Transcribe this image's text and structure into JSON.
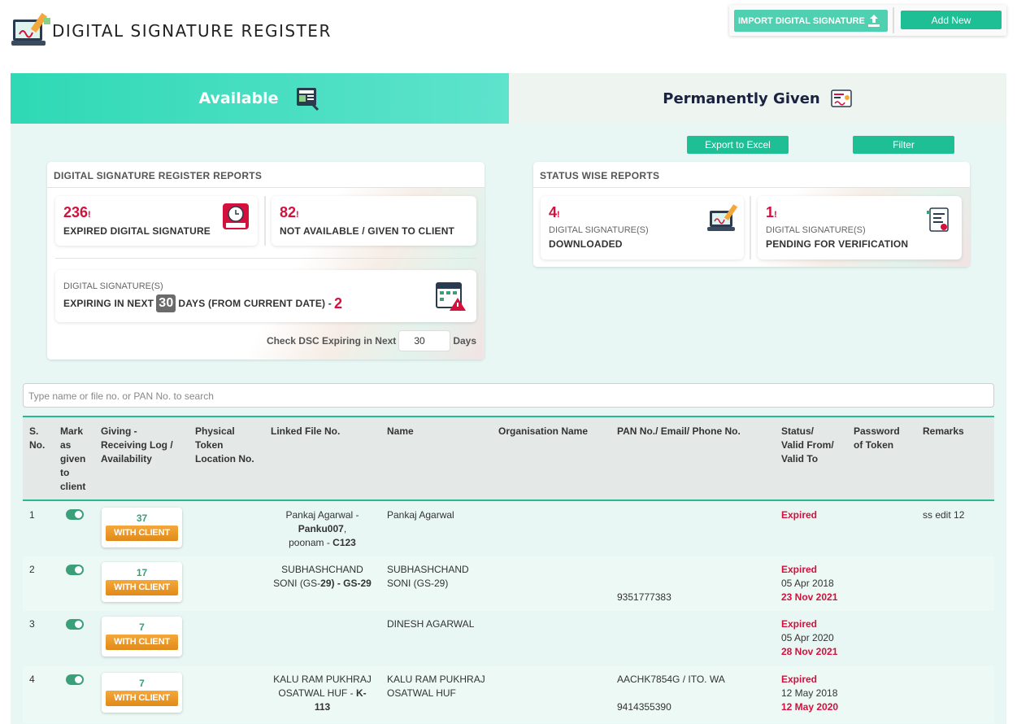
{
  "header": {
    "title": "DIGITAL SIGNATURE REGISTER",
    "import_label": "IMPORT DIGITAL SIGNATURE",
    "add_label": "Add New"
  },
  "tabs": {
    "available": "Available",
    "permanently_given": "Permanently Given"
  },
  "actions": {
    "export_label": "Export to Excel",
    "filter_label": "Filter"
  },
  "reports": {
    "title": "DIGITAL SIGNATURE REGISTER REPORTS",
    "expired_count": "236",
    "expired_label": "EXPIRED DIGITAL SIGNATURE",
    "not_available_count": "82",
    "not_available_label": "NOT AVAILABLE / GIVEN TO CLIENT",
    "expiring_sub": "DIGITAL SIGNATURE(S)",
    "expiring_prefix": "EXPIRING IN NEXT",
    "expiring_days": "30",
    "expiring_suffix": "DAYS (FROM CURRENT DATE) -",
    "expiring_count": "2",
    "check_label": "Check DSC Expiring in Next",
    "check_value": "30",
    "check_unit": "Days",
    "exclaim": "!"
  },
  "status_reports": {
    "title": "STATUS WISE REPORTS",
    "downloaded_count": "4",
    "downloaded_sub": "DIGITAL SIGNATURE(S)",
    "downloaded_label": "DOWNLOADED",
    "pending_count": "1",
    "pending_sub": "DIGITAL SIGNATURE(S)",
    "pending_label": "PENDING FOR VERIFICATION"
  },
  "search": {
    "placeholder": "Type name or file no. or PAN No. to search"
  },
  "table": {
    "headers": {
      "sno": [
        "S.",
        "No."
      ],
      "mark": [
        "Mark",
        "as",
        "given",
        "to",
        "client"
      ],
      "log": [
        "Giving -",
        "Receiving Log /",
        "Availability"
      ],
      "location": [
        "Physical",
        "Token",
        "Location No."
      ],
      "file": "Linked File No.",
      "name": "Name",
      "org": "Organisation Name",
      "pan": "PAN No./ Email/ Phone No.",
      "status": [
        "Status/",
        "Valid From/",
        "Valid To"
      ],
      "password": [
        "Password",
        "of Token"
      ],
      "remarks": "Remarks"
    },
    "badge_label": "WITH CLIENT",
    "rows": [
      {
        "sno": "1",
        "log_count": "37",
        "file_line1": "Pankaj Agarwal -",
        "file_bold1": "Panku007",
        "file_line2_tail": ",",
        "file_line3": "poonam -",
        "file_bold3": "C123",
        "name": "Pankaj Agarwal",
        "pan1": "",
        "pan2": "",
        "status": "Expired",
        "valid_from": "",
        "valid_to": "",
        "remarks": "ss edit 12"
      },
      {
        "sno": "2",
        "log_count": "17",
        "file_line1": "SUBHASHCHAND",
        "file_line2": "SONI (GS-",
        "file_bold2": "29) - GS-29",
        "name_line1": "SUBHASHCHAND",
        "name_line2": "SONI (GS-29)",
        "pan2": "9351777383",
        "status": "Expired",
        "valid_from": "05 Apr 2018",
        "valid_to": "23 Nov 2021",
        "remarks": ""
      },
      {
        "sno": "3",
        "log_count": "7",
        "name": "DINESH AGARWAL",
        "status": "Expired",
        "valid_from": "05 Apr 2020",
        "valid_to": "28 Nov 2021",
        "remarks": ""
      },
      {
        "sno": "4",
        "log_count": "7",
        "file_line1": "KALU RAM PUKHRAJ",
        "file_line2": "OSATWAL HUF -",
        "file_bold2": "K-113",
        "name_line1": "KALU RAM PUKHRAJ",
        "name_line2": "OSATWAL HUF",
        "pan1": "AACHK7854G / ITO. WA",
        "pan2": "9414355390",
        "status": "Expired",
        "valid_from": "12 May 2018",
        "valid_to": "12 May 2020",
        "remarks": ""
      }
    ]
  }
}
